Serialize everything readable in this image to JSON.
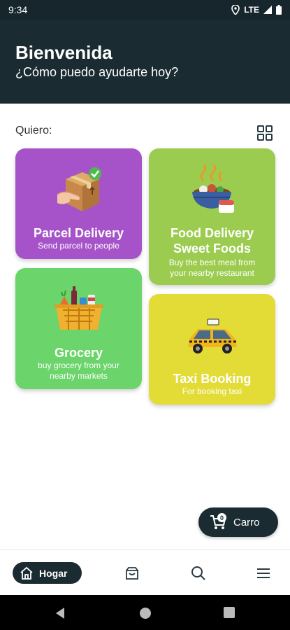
{
  "status_bar": {
    "time": "9:34",
    "network": "LTE"
  },
  "header": {
    "title": "Bienvenida",
    "subtitle": "¿Cómo puedo ayudarte hoy?"
  },
  "section": {
    "label": "Quiero:",
    "grid_icon": "grid-icon"
  },
  "cards": [
    {
      "title": "Parcel Delivery",
      "subtitle": "Send parcel to people",
      "icon": "parcel-box-icon",
      "color": "#a653c9"
    },
    {
      "title": "Food Delivery",
      "title2": "Sweet Foods",
      "subtitle": "Buy the best meal from",
      "subtitle2": "your nearby restaurant",
      "icon": "food-bowl-icon",
      "color": "#9ccc4f"
    },
    {
      "title": "Grocery",
      "subtitle": "buy grocery from your",
      "subtitle2": "nearby markets",
      "icon": "grocery-basket-icon",
      "color": "#6bd46a"
    },
    {
      "title": "Taxi Booking",
      "subtitle": "For booking taxi",
      "icon": "taxi-icon",
      "color": "#e3dc37"
    }
  ],
  "cart": {
    "label": "Carro",
    "count": "0"
  },
  "bottom_nav": {
    "home_label": "Hogar",
    "items": [
      "home-icon",
      "shop-bag-icon",
      "search-icon",
      "menu-icon"
    ]
  },
  "colors": {
    "primary": "#1b2b32"
  }
}
